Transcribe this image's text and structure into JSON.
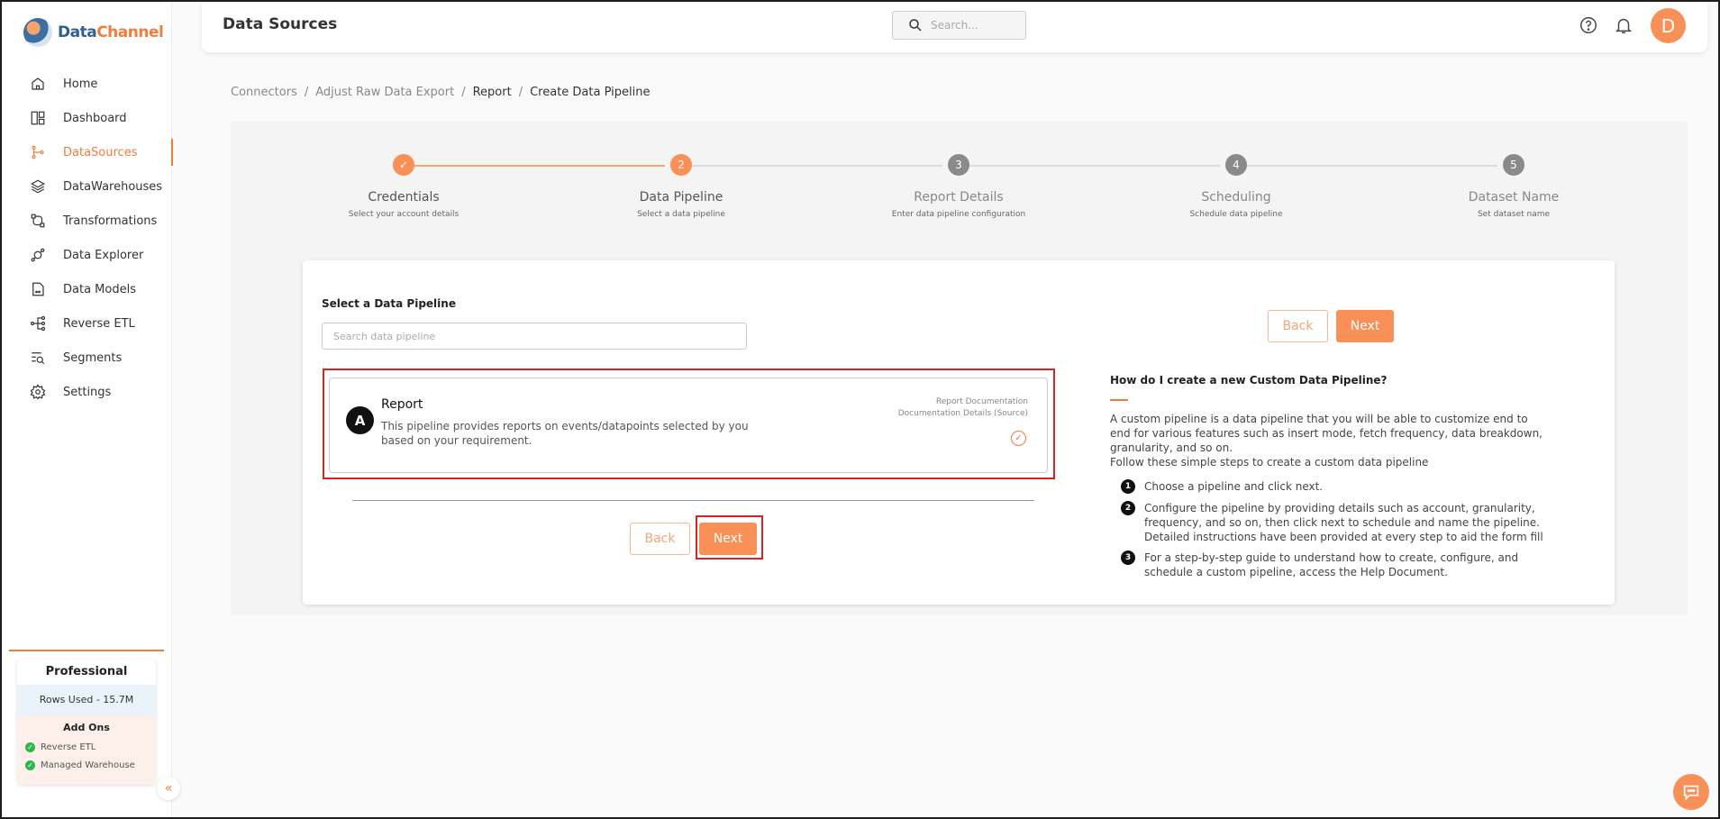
{
  "app": {
    "logo_part1": "Data",
    "logo_part2": "Channel"
  },
  "sidebar": {
    "items": [
      {
        "label": "Home",
        "icon": "home-icon"
      },
      {
        "label": "Dashboard",
        "icon": "dashboard-icon"
      },
      {
        "label": "DataSources",
        "icon": "datasources-icon",
        "active": true
      },
      {
        "label": "DataWarehouses",
        "icon": "layers-icon"
      },
      {
        "label": "Transformations",
        "icon": "transform-icon"
      },
      {
        "label": "Data Explorer",
        "icon": "explorer-icon"
      },
      {
        "label": "Data Models",
        "icon": "model-icon"
      },
      {
        "label": "Reverse ETL",
        "icon": "reverse-etl-icon"
      },
      {
        "label": "Segments",
        "icon": "segments-icon"
      },
      {
        "label": "Settings",
        "icon": "gear-icon"
      }
    ],
    "plan": {
      "title": "Professional",
      "rows_used": "Rows Used - 15.7M",
      "addons_title": "Add Ons",
      "addons": [
        "Reverse ETL",
        "Managed Warehouse"
      ]
    },
    "collapse_glyph": "«"
  },
  "header": {
    "title": "Data Sources",
    "search_placeholder": "Search...",
    "avatar_initial": "D"
  },
  "breadcrumb": {
    "items": [
      "Connectors",
      "Adjust Raw Data Export",
      "Report",
      "Create Data Pipeline"
    ],
    "separator": "/"
  },
  "stepper": {
    "steps": [
      {
        "number": "✓",
        "title": "Credentials",
        "subtitle": "Select your account details",
        "state": "done"
      },
      {
        "number": "2",
        "title": "Data Pipeline",
        "subtitle": "Select a data pipeline",
        "state": "active"
      },
      {
        "number": "3",
        "title": "Report Details",
        "subtitle": "Enter data pipeline configuration",
        "state": "pending"
      },
      {
        "number": "4",
        "title": "Scheduling",
        "subtitle": "Schedule data pipeline",
        "state": "pending"
      },
      {
        "number": "5",
        "title": "Dataset Name",
        "subtitle": "Set dataset name",
        "state": "pending"
      }
    ]
  },
  "pipeline_select": {
    "label": "Select a Data Pipeline",
    "search_placeholder": "Search data pipeline",
    "item": {
      "logo_glyph": "A",
      "name": "Report",
      "description": "This pipeline provides reports on events/datapoints selected by you based on your requirement.",
      "doc_link_1": "Report Documentation",
      "doc_link_2": "Documentation Details (Source)",
      "selected_glyph": "✓"
    }
  },
  "buttons": {
    "back": "Back",
    "next": "Next"
  },
  "help": {
    "title": "How do I create a new Custom Data Pipeline?",
    "intro": "A custom pipeline is a data pipeline that you will be able to customize end to end for various features such as insert mode, fetch frequency, data breakdown, granularity, and so on.",
    "follow": "Follow these simple steps to create a custom data pipeline",
    "steps": [
      {
        "num": "1",
        "text": "Choose a pipeline and click next."
      },
      {
        "num": "2",
        "text": "Configure the pipeline by providing details such as account, granularity, frequency, and so on, then click next to schedule and name the pipeline. Detailed instructions have been provided at every step to aid the form fill"
      },
      {
        "num": "3",
        "text": "For a step-by-step guide to understand how to create, configure, and schedule a custom pipeline, access the Help Document."
      }
    ]
  },
  "colors": {
    "accent": "#f27c3c",
    "accent_light": "#f89057",
    "highlight_red": "#d62424",
    "step_pending": "#8a8a8a"
  }
}
